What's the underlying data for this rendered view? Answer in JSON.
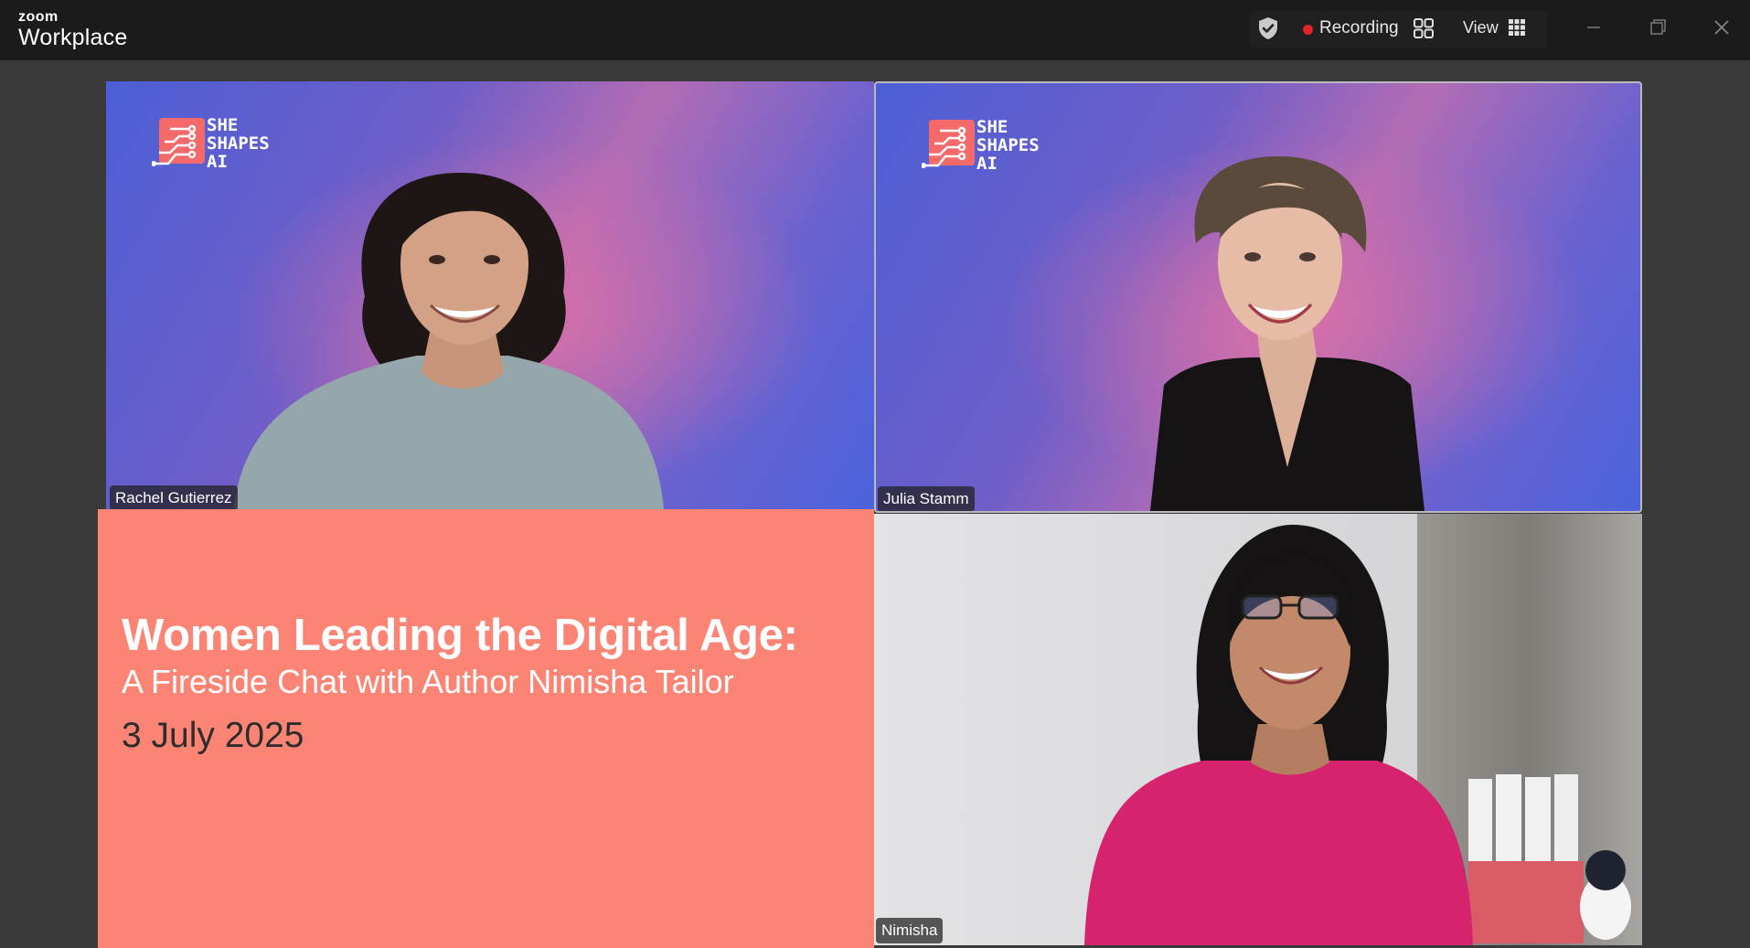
{
  "app": {
    "brand_small": "zoom",
    "brand_name": "Workplace"
  },
  "toolbar": {
    "security_icon": "shield-check-icon",
    "recording_label": "Recording",
    "recording_color": "#e0262b",
    "gallery_icon": "gallery-grid-icon",
    "view_label": "View",
    "view_icon": "view-grid-icon"
  },
  "window_controls": [
    "minimize",
    "maximize",
    "close"
  ],
  "participants": [
    {
      "name": "Rachel Gutierrez",
      "background_logo": [
        "SHE",
        "SHAPES",
        "AI"
      ]
    },
    {
      "name": "Julia Stamm",
      "background_logo": [
        "SHE",
        "SHAPES",
        "AI"
      ],
      "active_speaker": true
    },
    {
      "name": "Nimisha"
    }
  ],
  "shared_slide": {
    "title": "Women Leading the Digital Age:",
    "subtitle": "A Fireside Chat with Author Nimisha Tailor",
    "date": "3 July 2025",
    "background_color": "#fb8474"
  },
  "colors": {
    "titlebar": "#1b1b1b",
    "stage": "#3a3a3a",
    "brand_gradient_blue": "#4d5fd6",
    "brand_gradient_pink": "#de70a5"
  }
}
